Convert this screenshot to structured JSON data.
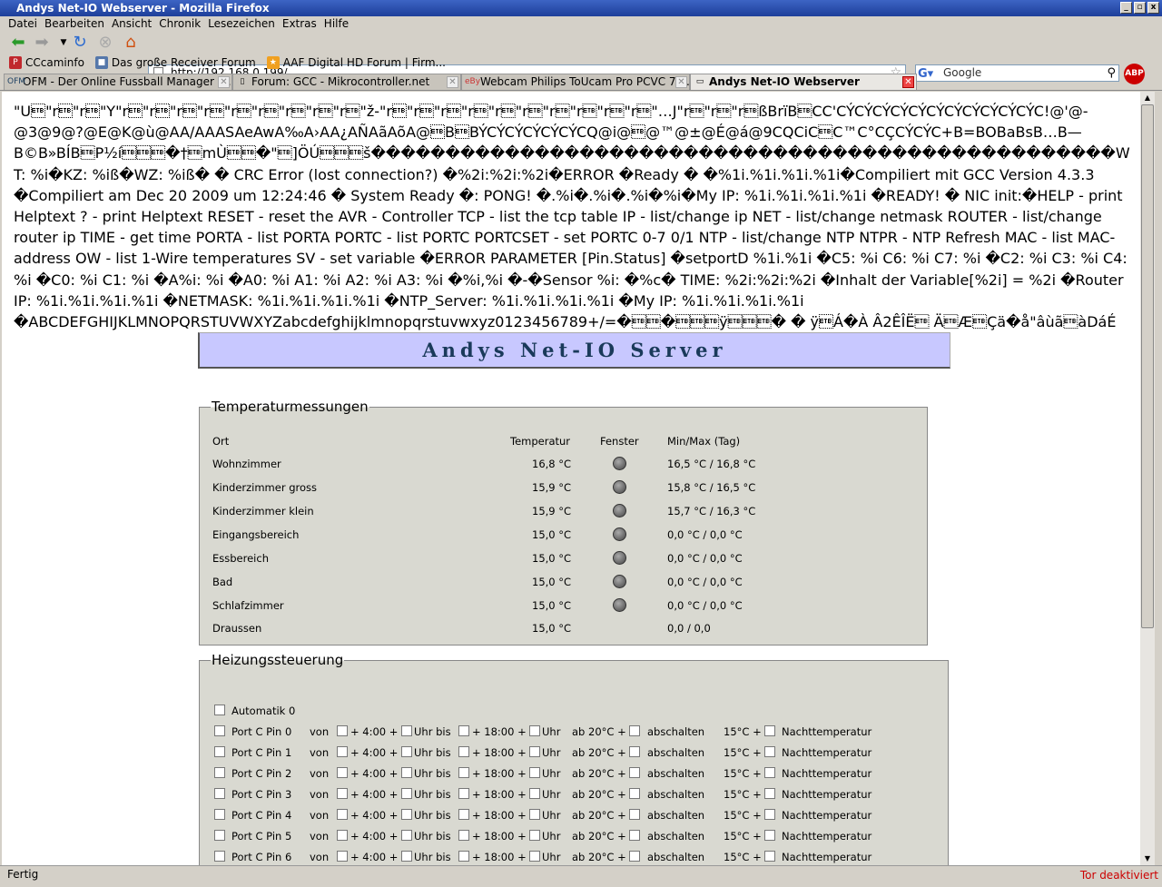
{
  "window": {
    "title": "Andys Net-IO Webserver - Mozilla Firefox"
  },
  "menu": [
    "Datei",
    "Bearbeiten",
    "Ansicht",
    "Chronik",
    "Lesezeichen",
    "Extras",
    "Hilfe"
  ],
  "nav": {
    "url": "http://192.168.0.199/",
    "search_engine": "Google",
    "search_placeholder": "Google"
  },
  "bookmarks": [
    {
      "label": "CCcaminfo",
      "color": "#c0282d",
      "icon": "P"
    },
    {
      "label": "Das große Receiver Forum",
      "color": "#ff8d1c",
      "icon": "■"
    },
    {
      "label": "AAF Digital HD Forum | Firm...",
      "color": "#f0a020",
      "icon": "★"
    }
  ],
  "tabs": [
    {
      "label": "OFM - Der Online Fussball Manager i...",
      "icon": "OFM",
      "active": false
    },
    {
      "label": "Forum: GCC - Mikrocontroller.net",
      "icon": "▯",
      "active": false
    },
    {
      "label": "Webcam Philips ToUcam Pro PCVC 74...",
      "icon": "eBy",
      "active": false
    },
    {
      "label": "Andys Net-IO Webserver",
      "icon": "▭",
      "active": true
    }
  ],
  "page": {
    "garbled": "\"U\u0017\"r\u0017\"r\u0017\"Y\"r\u0017\"r\u0017\"r\u0017\"r\u0017\"r\u0017\"r\u0017\"r\u0017\"r\u0017\"r\u0017\"ž-\"r\u0017\"r\u0017\"r\u0017\"r\u0017\"r\u0017\"r\u0017\"r\u0017\"r\u0017\"r\u0017\"r\u0017\"…J\"r\u0017\"r\u0017\"r\u0017ßBrïB\u0017CC'CÝCÝCÝCÝCÝCÝCÝCÝCÝCÝCÝC!@'@-@3@9@?@E@K@ù@AA/AAASAeAwA‰A›AA¿AÑAãAõA@\u0017B\u0017BÝCÝCÝCÝCÝCÝCQ@i@\u0017@™@±@É@á@9CQCiC\u0017C™C°CÇCÝCÝC+B=BOBaBsB…B—B©B»BÍB\u0017P½í\u0017\u0017\u0017�†\u0017mÙ\u0017\u0017�\"\u0017]ÖÚ\u0017\u0017\u0017š��������������������������������������������������WT: %i�KZ: %iß�WZ: %iß� � CRC Error (lost connection?) �%2i:%2i:%2i�ERROR �Ready � �%1i.%1i.%1i.%1i�Compiliert mit GCC Version 4.3.3 �Compiliert am Dec 20 2009 um 12:24:46 � System Ready �: PONG! �.%i�.%i�.%i�%i�My IP: %1i.%1i.%1i.%1i �READY! � NIC init:�HELP - print Helptext ? - print Helptext RESET - reset the AVR - Controller TCP - list the tcp table IP - list/change ip NET - list/change netmask ROUTER - list/change router ip TIME - get time PORTA - list PORTA PORTC - list PORTC PORTCSET - set PORTC 0-7 0/1 NTP - list/change NTP NTPR - NTP Refresh MAC - list MAC-address OW - list 1-Wire temperatures SV - set variable �ERROR PARAMETER [Pin.Status] �setportD %1i.%1i �C5: %i C6: %i C7: %i �C2: %i C3: %i C4: %i �C0: %i C1: %i �A%i: %i �A0: %i A1: %i A2: %i A3: %i �%i,%i �-�Sensor %i: �%c� TIME: %2i:%2i:%2i �Inhalt der Variable[%2i] = %2i �Router IP: %1i.%1i.%1i.%1i �NETMASK: %1i.%1i.%1i.%1i �NTP_Server: %1i.%1i.%1i.%1i �My IP: %1i.%1i.%1i.%1i �ABCDEFGHIJKLMNOPQRSTUVWXYZabcdefghijklmnopqrstuvwxyz0123456789+/=�\u0017\u0017�\u0017\u0017\u0017ÿ\u0017\u0017\u0017� � ÿ\u0017Á�À Â2ÊÎË\u0017 Ä\u0017Æ\u0017Çä�å\"âùã\u0017àDáÉ",
    "header": "Andys Net-IO Server"
  },
  "temp": {
    "legend": "Temperaturmessungen",
    "headers": {
      "ort": "Ort",
      "temp": "Temperatur",
      "fenster": "Fenster",
      "minmax": "Min/Max (Tag)"
    },
    "rows": [
      {
        "ort": "Wohnzimmer",
        "temp": "16,8 °C",
        "led": true,
        "minmax": "16,5 °C / 16,8 °C"
      },
      {
        "ort": "Kinderzimmer gross",
        "temp": "15,9 °C",
        "led": true,
        "minmax": "15,8 °C / 16,5 °C"
      },
      {
        "ort": "Kinderzimmer klein",
        "temp": "15,9 °C",
        "led": true,
        "minmax": "15,7 °C / 16,3 °C"
      },
      {
        "ort": "Eingangsbereich",
        "temp": "15,0 °C",
        "led": true,
        "minmax": "0,0 °C / 0,0 °C"
      },
      {
        "ort": "Essbereich",
        "temp": "15,0 °C",
        "led": true,
        "minmax": "0,0 °C / 0,0 °C"
      },
      {
        "ort": "Bad",
        "temp": "15,0 °C",
        "led": true,
        "minmax": "0,0 °C / 0,0 °C"
      },
      {
        "ort": "Schlafzimmer",
        "temp": "15,0 °C",
        "led": true,
        "minmax": "0,0 °C / 0,0 °C"
      },
      {
        "ort": "Draussen",
        "temp": "15,0 °C",
        "led": false,
        "minmax": "0,0 / 0,0"
      }
    ]
  },
  "heiz": {
    "legend": "Heizungssteuerung",
    "auto": "Automatik 0",
    "labels": {
      "von": "von",
      "start": "+ 4:00 +",
      "uhrbis": "Uhr bis",
      "end": "+ 18:00 +",
      "uhr": "Uhr",
      "ab": "ab 20°C +",
      "abschalten": "abschalten",
      "t15": "15°C +",
      "nacht": "Nachttemperatur"
    },
    "pins": [
      "Port C Pin 0",
      "Port C Pin 1",
      "Port C Pin 2",
      "Port C Pin 3",
      "Port C Pin 4",
      "Port C Pin 5",
      "Port C Pin 6"
    ]
  },
  "status": {
    "text": "Fertig",
    "tor": "Tor deaktiviert"
  }
}
